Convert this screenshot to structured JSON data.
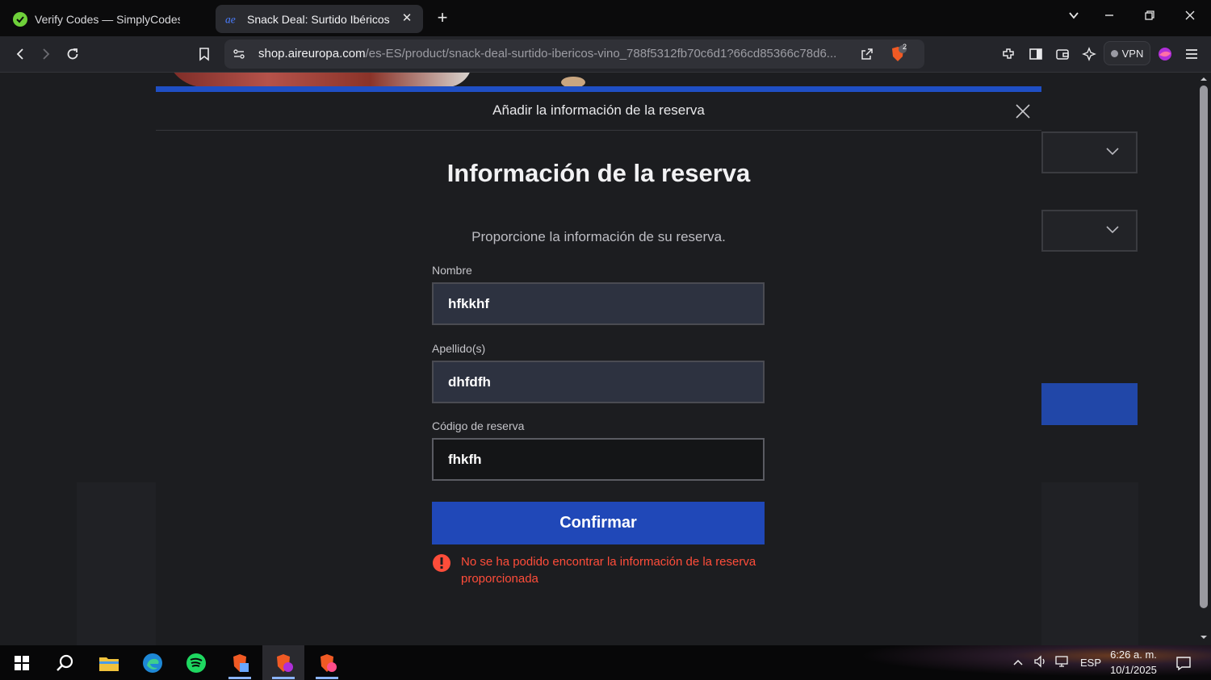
{
  "browser": {
    "tabs": [
      {
        "title": "Verify Codes — SimplyCodes",
        "icon": "simplycodes-icon",
        "active": false
      },
      {
        "title": "Snack Deal: Surtido Ibéricos + Vino",
        "icon": "aireuropa-icon",
        "active": true
      }
    ],
    "url_host": "shop.aireuropa.com",
    "url_path": "/es-ES/product/snack-deal-surtido-ibericos-vino_788f5312fb70c6d1?66cd85366c78d6...",
    "brave_badge": "2",
    "vpn_label": "VPN"
  },
  "modal": {
    "header_title": "Añadir la información de la reserva",
    "title": "Información de la reserva",
    "subtitle": "Proporcione la información de su reserva.",
    "fields": {
      "nombre": {
        "label": "Nombre",
        "value": "hfkkhf"
      },
      "apellidos": {
        "label": "Apellido(s)",
        "value": "dhfdfh"
      },
      "codigo": {
        "label": "Código de reserva",
        "value": "fhkfh"
      }
    },
    "confirm_label": "Confirmar",
    "error_message": "No se ha podido encontrar la información de la reserva proporcionada"
  },
  "taskbar": {
    "language": "ESP",
    "time": "6:26 a. m.",
    "date": "10/1/2025"
  },
  "colors": {
    "accent": "#1f4fc4",
    "button": "#2048b8",
    "error": "#ff4d3a"
  }
}
